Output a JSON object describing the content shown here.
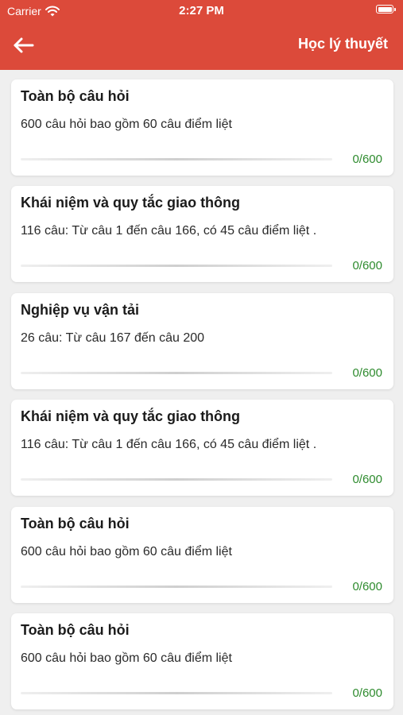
{
  "status_bar": {
    "carrier": "Carrier",
    "time": "2:27 PM"
  },
  "nav": {
    "title": "Học lý thuyết",
    "back_icon": "arrow-left-icon"
  },
  "colors": {
    "header": "#dc4a3a",
    "progress_text": "#2e8b2e"
  },
  "cards": [
    {
      "title": "Toàn bộ câu hỏi",
      "desc": "600 câu hỏi bao gồm 60 câu điểm liệt",
      "count": "0/600",
      "progress": 0
    },
    {
      "title": "Khái niệm và quy tắc giao thông",
      "desc": "116 câu: Từ câu 1 đến câu 166, có 45 câu điểm liệt .",
      "count": "0/600",
      "progress": 0
    },
    {
      "title": "Nghiệp vụ vận tải",
      "desc": "26 câu: Từ câu 167 đến câu 200",
      "count": "0/600",
      "progress": 0
    },
    {
      "title": "Khái niệm và quy tắc giao thông",
      "desc": "116 câu: Từ câu 1 đến câu 166, có 45 câu điểm liệt .",
      "count": "0/600",
      "progress": 0
    },
    {
      "title": "Toàn bộ câu hỏi",
      "desc": "600 câu hỏi bao gồm 60 câu điểm liệt",
      "count": "0/600",
      "progress": 0
    },
    {
      "title": "Toàn bộ câu hỏi",
      "desc": "600 câu hỏi bao gồm 60 câu điểm liệt",
      "count": "0/600",
      "progress": 0
    }
  ]
}
